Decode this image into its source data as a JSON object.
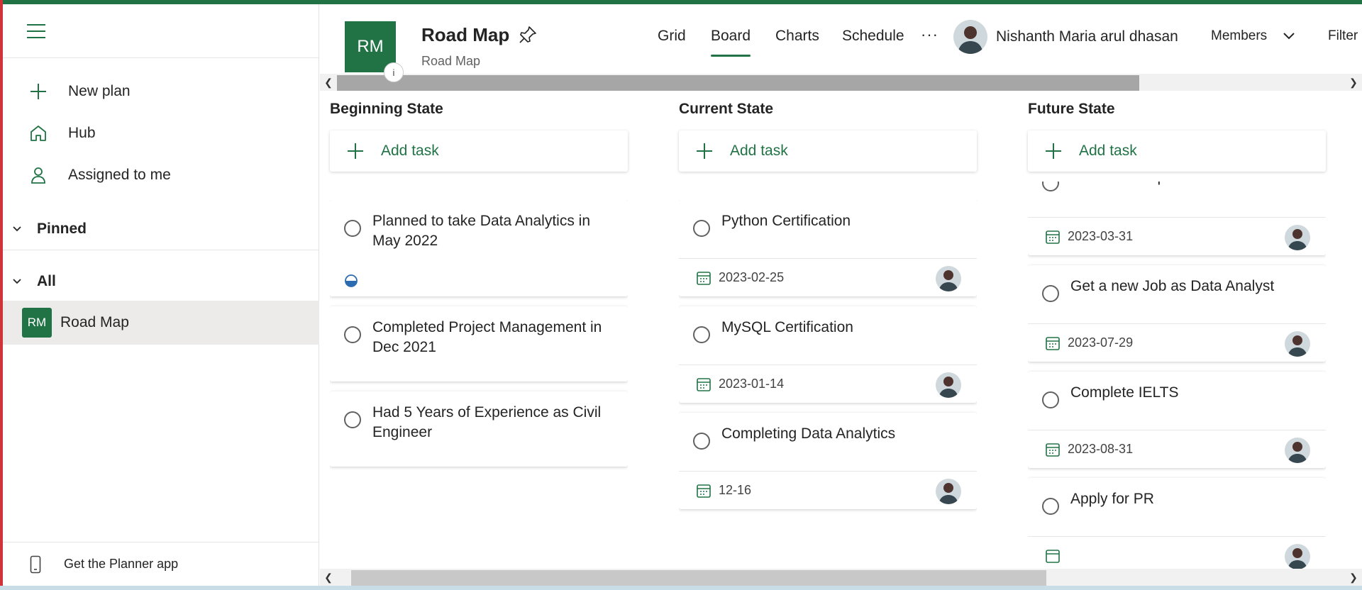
{
  "sidebar": {
    "nav": [
      {
        "label": "New plan",
        "icon": "plus-icon"
      },
      {
        "label": "Hub",
        "icon": "home-icon"
      },
      {
        "label": "Assigned to me",
        "icon": "person-icon"
      }
    ],
    "pinned_label": "Pinned",
    "all_label": "All",
    "plans": [
      {
        "badge": "RM",
        "label": "Road Map"
      }
    ],
    "get_app_label": "Get the Planner app"
  },
  "header": {
    "logo_initials": "RM",
    "plan_title": "Road Map",
    "plan_subtitle": "Road Map",
    "views": [
      "Grid",
      "Board",
      "Charts",
      "Schedule"
    ],
    "active_view": "Board",
    "more_label": "···",
    "user_name": "Nishanth Maria arul dhasan",
    "members_label": "Members",
    "filter_label": "Filter"
  },
  "board": {
    "add_task_label": "Add task",
    "buckets": [
      {
        "name": "Beginning State",
        "tasks": [
          {
            "title": "Planned to take Data Analytics in May 2022",
            "progress": "in-progress"
          },
          {
            "title": "Completed Project Management in Dec 2021"
          },
          {
            "title": "Had 5 Years of Experience as Civil Engineer"
          }
        ]
      },
      {
        "name": "Current State",
        "tasks": [
          {
            "title": "Python Certification",
            "due": "2023-02-25",
            "assigned": true
          },
          {
            "title": "MySQL Certification",
            "due": "2023-01-14",
            "assigned": true
          },
          {
            "title": "Completing Data Analytics",
            "due": "12-16",
            "assigned": true
          }
        ]
      },
      {
        "name": "Future State",
        "tasks": [
          {
            "title": "Interview Preparation",
            "due": "2023-03-31",
            "assigned": true
          },
          {
            "title": "Get a new Job as Data Analyst",
            "due": "2023-07-29",
            "assigned": true
          },
          {
            "title": "Complete IELTS",
            "due": "2023-08-31",
            "assigned": true
          },
          {
            "title": "Apply for PR",
            "due": "",
            "assigned": true
          }
        ]
      }
    ]
  },
  "colors": {
    "brand": "#217346",
    "selected_bg": "#edebe9",
    "scroll_thumb": "#a6a6a6"
  }
}
